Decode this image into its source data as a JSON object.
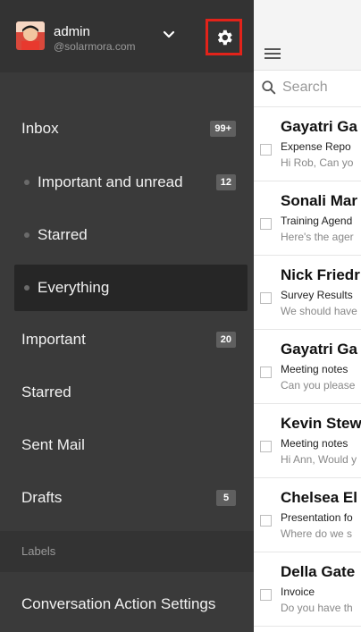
{
  "account": {
    "name": "admin",
    "domain": "@solarmora.com"
  },
  "nav": {
    "items": [
      {
        "label": "Inbox",
        "badge": "99+"
      },
      {
        "label": "Important and unread",
        "badge": "12"
      },
      {
        "label": "Starred",
        "badge": ""
      },
      {
        "label": "Everything",
        "badge": ""
      },
      {
        "label": "Important",
        "badge": "20"
      },
      {
        "label": "Starred",
        "badge": ""
      },
      {
        "label": "Sent Mail",
        "badge": ""
      },
      {
        "label": "Drafts",
        "badge": "5"
      }
    ],
    "labels_header": "Labels",
    "conversation_settings": "Conversation Action Settings"
  },
  "search": {
    "placeholder": "Search"
  },
  "emails": [
    {
      "sender": "Gayatri Ga",
      "subject": "Expense Repo",
      "snippet": "Hi Rob, Can yo"
    },
    {
      "sender": "Sonali Mar",
      "subject": "Training Agend",
      "snippet": "Here's the ager"
    },
    {
      "sender": "Nick Friedr",
      "subject": "Survey Results",
      "snippet": "We should have"
    },
    {
      "sender": "Gayatri Ga",
      "subject": "Meeting notes",
      "snippet": "Can you please"
    },
    {
      "sender": "Kevin Stew",
      "subject": "Meeting notes",
      "snippet": "Hi Ann, Would y"
    },
    {
      "sender": "Chelsea El",
      "subject": "Presentation fo",
      "snippet": "Where do we s"
    },
    {
      "sender": "Della Gate",
      "subject": "Invoice",
      "snippet": "Do you have th"
    }
  ],
  "colors": {
    "drawer_bg": "#3a3a3a",
    "account_bg": "#333333",
    "active_bg": "#262626",
    "highlight_border": "#e2231a",
    "badge_bg": "#5f5f5f"
  },
  "icons": {
    "settings": "gear-icon",
    "account_menu": "chevron-down-icon",
    "menu": "hamburger-icon",
    "search": "search-icon"
  }
}
